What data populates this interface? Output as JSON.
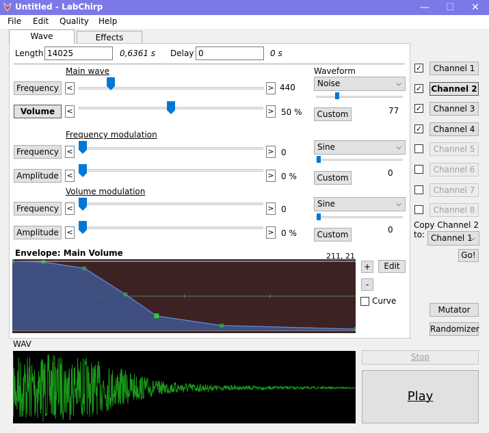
{
  "window": {
    "title": "Untitled - LabChirp",
    "minimize": "—",
    "maximize": "☐",
    "close": "✕"
  },
  "menu": [
    "File",
    "Edit",
    "Quality",
    "Help"
  ],
  "tabs": [
    "Wave",
    "Effects"
  ],
  "length": {
    "label": "Length",
    "value": "14025",
    "seconds": "0,6361 s"
  },
  "delay": {
    "label": "Delay",
    "value": "0",
    "seconds": "0 s"
  },
  "main_wave": {
    "heading": "Main wave",
    "frequency": {
      "label": "Frequency",
      "value": "440",
      "level": 0.16
    },
    "volume": {
      "label": "Volume",
      "value": "50 %",
      "level": 0.5
    }
  },
  "waveform": {
    "heading": "Waveform",
    "selected": "Noise",
    "custom_label": "Custom",
    "value": "77",
    "level": 0.26
  },
  "freq_mod": {
    "heading": "Frequency modulation",
    "frequency": {
      "label": "Frequency",
      "value": "0",
      "level": 0
    },
    "amplitude": {
      "label": "Amplitude",
      "value": "0 %",
      "level": 0
    },
    "waveform": "Sine",
    "custom_label": "Custom",
    "value": "0"
  },
  "vol_mod": {
    "heading": "Volume modulation",
    "frequency": {
      "label": "Frequency",
      "value": "0",
      "level": 0
    },
    "amplitude": {
      "label": "Amplitude",
      "value": "0 %",
      "level": 0
    },
    "waveform": "Sine",
    "custom_label": "Custom",
    "value": "0"
  },
  "envelope": {
    "title": "Envelope: Main Volume",
    "coords": "211, 21",
    "add": "+",
    "remove": "-",
    "edit": "Edit",
    "curve": "Curve",
    "points": [
      [
        0,
        1.0
      ],
      [
        0.09,
        0.99
      ],
      [
        0.21,
        0.9
      ],
      [
        0.33,
        0.52
      ],
      [
        0.42,
        0.21
      ],
      [
        0.61,
        0.07
      ],
      [
        1.0,
        0.02
      ]
    ],
    "selected_point": 4
  },
  "wav_label": "WAV",
  "channels": [
    {
      "label": "Channel 1",
      "checked": true,
      "enabled": true,
      "active": false
    },
    {
      "label": "Channel 2",
      "checked": true,
      "enabled": true,
      "active": true
    },
    {
      "label": "Channel 3",
      "checked": true,
      "enabled": true,
      "active": false
    },
    {
      "label": "Channel 4",
      "checked": true,
      "enabled": true,
      "active": false
    },
    {
      "label": "Channel 5",
      "checked": false,
      "enabled": false,
      "active": false
    },
    {
      "label": "Channel 6",
      "checked": false,
      "enabled": false,
      "active": false
    },
    {
      "label": "Channel 7",
      "checked": false,
      "enabled": false,
      "active": false
    },
    {
      "label": "Channel 8",
      "checked": false,
      "enabled": false,
      "active": false
    }
  ],
  "copy": {
    "label": "Copy Channel 2 to:",
    "target": "Channel 1",
    "go": "Go!"
  },
  "mutator": "Mutator",
  "randomizer": "Randomizer",
  "stop": "Stop",
  "play": "Play",
  "colors": {
    "titlebar": "#7b79e8",
    "slider_thumb": "#0078d7",
    "envelope_bg": "#3d2224",
    "envelope_fill": "#3f4f80",
    "wave_bg": "#000000",
    "wave": "#1a9a1a"
  }
}
